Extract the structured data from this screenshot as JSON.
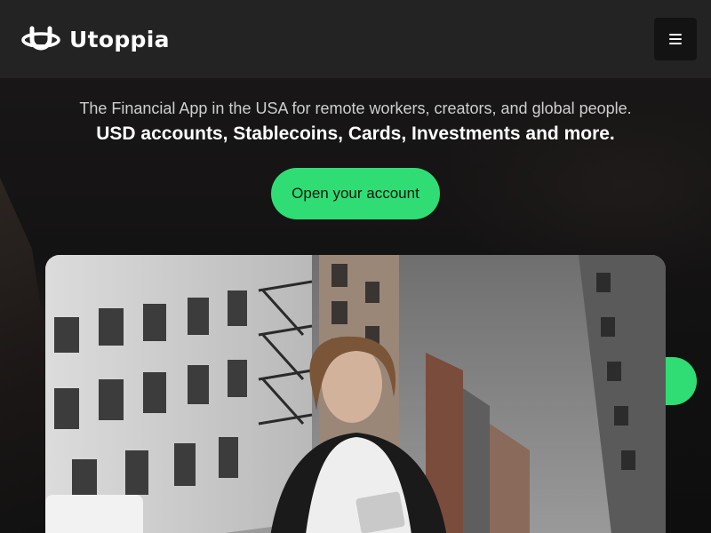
{
  "header": {
    "brand_name": "Utoppia",
    "logo_icon": "utoppia-logo-icon",
    "menu_icon": "hamburger-menu-icon"
  },
  "hero": {
    "subtitle": "The Financial App in the USA for remote workers, creators, and global people.",
    "title": "USD accounts, Stablecoins, Cards, Investments and more.",
    "cta_label": "Open your account"
  },
  "colors": {
    "accent": "#2fdd74",
    "header_bg": "#232323",
    "page_bg": "#141313"
  }
}
